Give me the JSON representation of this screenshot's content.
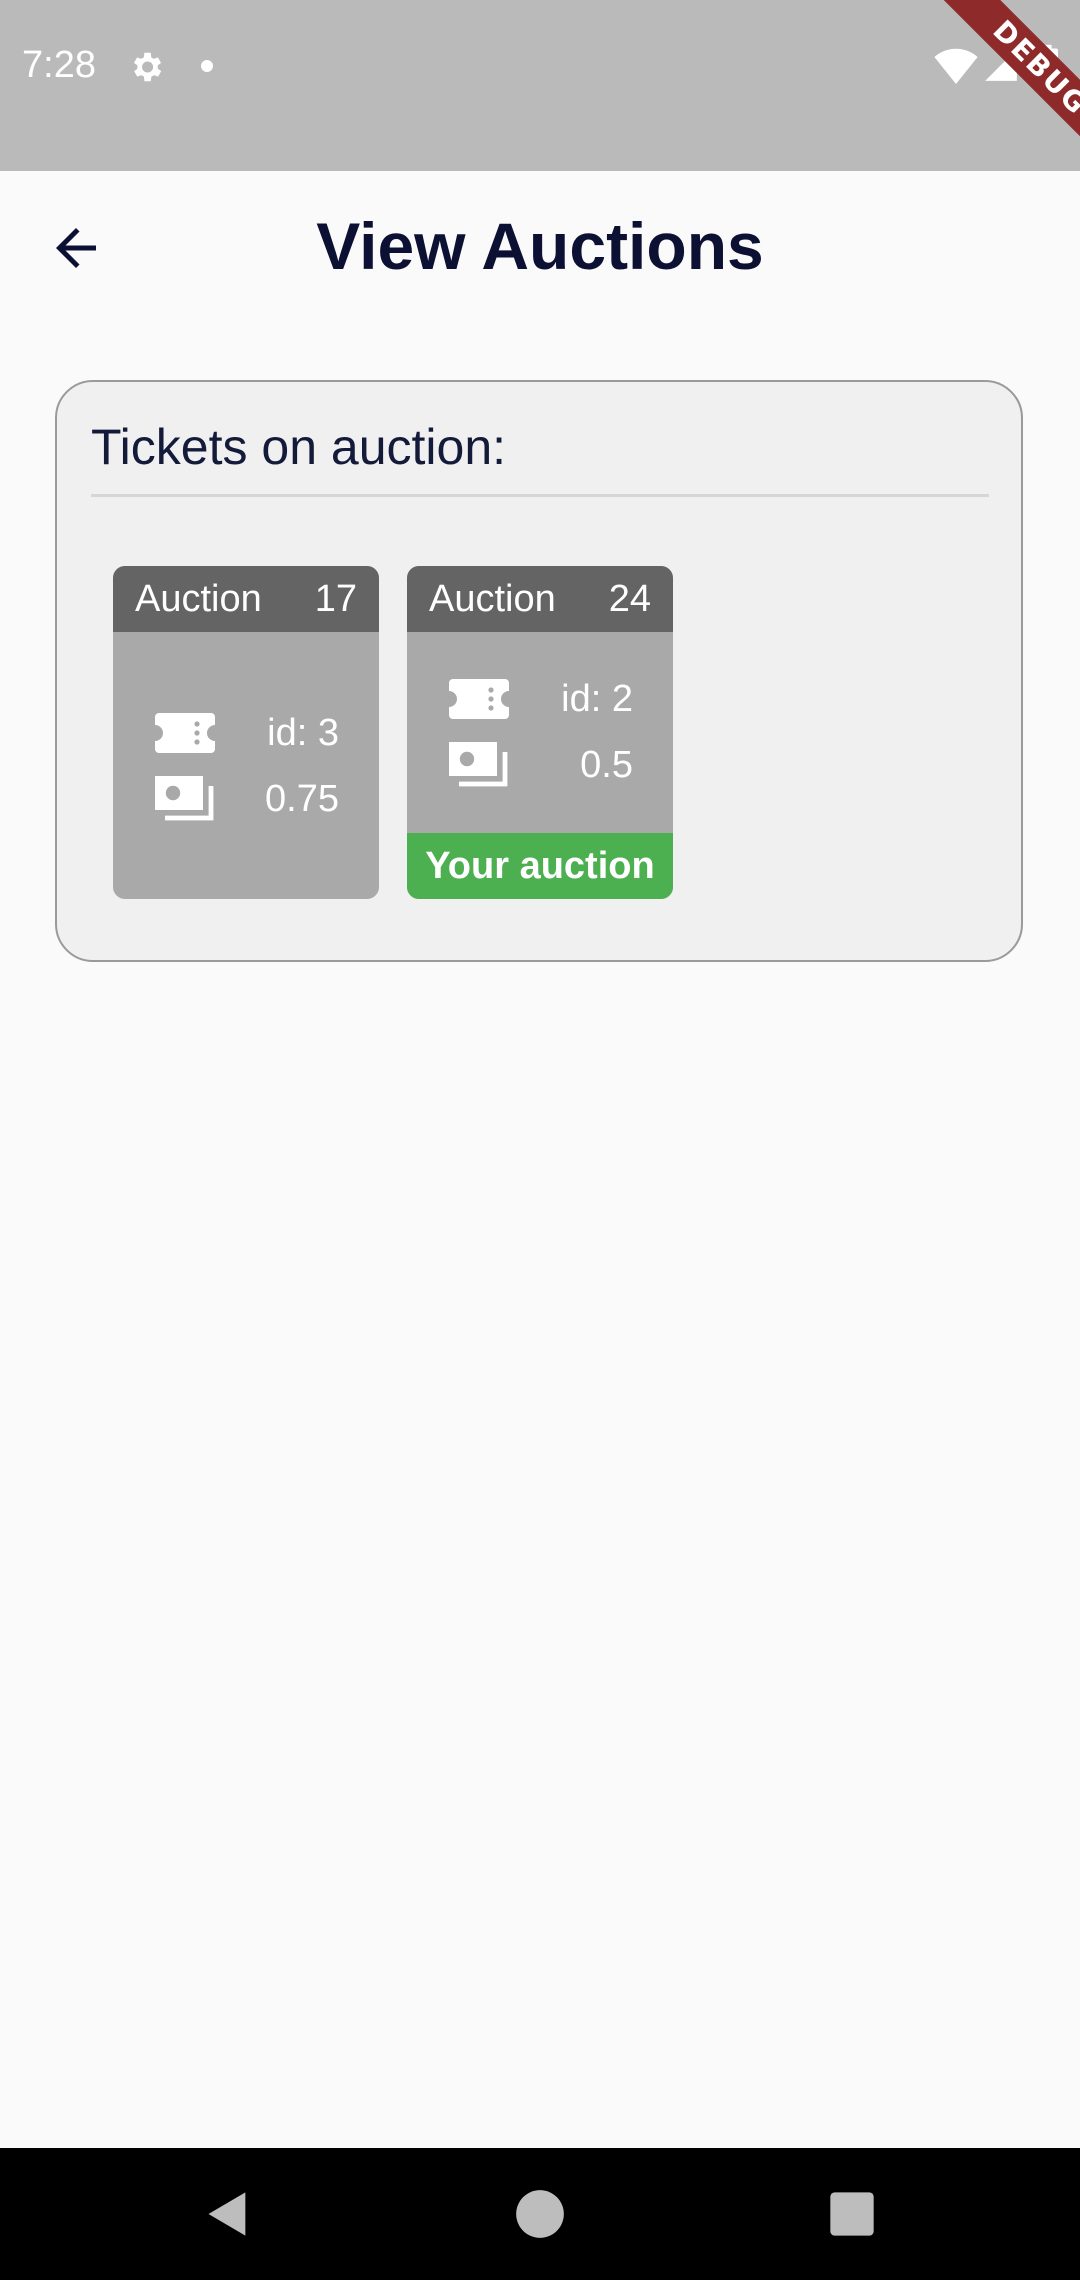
{
  "status_bar": {
    "time": "7:28",
    "debug_label": "DEBUG",
    "icons": [
      "gear-icon",
      "notification-dot-icon",
      "wifi-icon",
      "signal-icon",
      "battery-icon"
    ]
  },
  "header": {
    "title": "View Auctions",
    "back_icon": "arrow-back-icon"
  },
  "panel": {
    "heading": "Tickets on auction:",
    "auctions": [
      {
        "label": "Auction",
        "number": "17",
        "ticket_id": "id: 3",
        "price": "0.75",
        "footer": ""
      },
      {
        "label": "Auction",
        "number": "24",
        "ticket_id": "id: 2",
        "price": "0.5",
        "footer": "Your auction"
      }
    ]
  },
  "nav_bar": {
    "icons": [
      "nav-back-icon",
      "nav-home-icon",
      "nav-recents-icon"
    ]
  },
  "colors": {
    "status_bar": "#bababa",
    "title_text": "#0c1133",
    "tile_header": "#646464",
    "tile_body": "#a9a9a9",
    "own_auction": "#4caf50",
    "debug_ribbon": "#8e2a2a"
  }
}
